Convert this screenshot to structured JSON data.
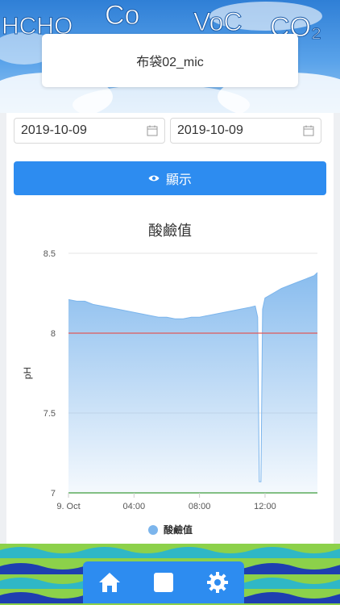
{
  "header": {
    "title": "布袋02_mic",
    "banner_words": [
      "HCHO",
      "Co",
      "VoC",
      "CO₂"
    ]
  },
  "filters": {
    "start_date": "2019-10-09",
    "end_date": "2019-10-09",
    "show_button_label": "顯示"
  },
  "chart_data": {
    "type": "area",
    "title": "酸鹼值",
    "ylabel": "pH",
    "ylim": [
      7,
      8.5
    ],
    "y_ticks": [
      "8.5",
      "8",
      "7.5",
      "7"
    ],
    "y_tick_values": [
      8.5,
      8,
      7.5,
      7
    ],
    "x_ticks": [
      "9. Oct",
      "04:00",
      "08:00",
      "12:00"
    ],
    "x_tick_hours": [
      0,
      4,
      8,
      12
    ],
    "x_range_hours": [
      0,
      15.2
    ],
    "reference_lines": [
      {
        "value": 8.0,
        "color": "#e05a5a"
      },
      {
        "value": 7.0,
        "color": "#3a9a3a"
      }
    ],
    "series": [
      {
        "name": "酸鹼值",
        "color": "#7cb5ec",
        "points": [
          [
            0.0,
            8.21
          ],
          [
            0.5,
            8.2
          ],
          [
            1.0,
            8.2
          ],
          [
            1.5,
            8.18
          ],
          [
            2.0,
            8.17
          ],
          [
            2.5,
            8.16
          ],
          [
            3.0,
            8.15
          ],
          [
            3.5,
            8.14
          ],
          [
            4.0,
            8.13
          ],
          [
            4.5,
            8.12
          ],
          [
            5.0,
            8.11
          ],
          [
            5.5,
            8.1
          ],
          [
            6.0,
            8.1
          ],
          [
            6.5,
            8.09
          ],
          [
            7.0,
            8.09
          ],
          [
            7.5,
            8.1
          ],
          [
            8.0,
            8.1
          ],
          [
            8.5,
            8.11
          ],
          [
            9.0,
            8.12
          ],
          [
            9.5,
            8.13
          ],
          [
            10.0,
            8.14
          ],
          [
            10.5,
            8.15
          ],
          [
            11.0,
            8.16
          ],
          [
            11.4,
            8.17
          ],
          [
            11.55,
            8.1
          ],
          [
            11.65,
            7.07
          ],
          [
            11.75,
            7.07
          ],
          [
            11.85,
            8.15
          ],
          [
            12.0,
            8.22
          ],
          [
            12.5,
            8.25
          ],
          [
            13.0,
            8.28
          ],
          [
            13.5,
            8.3
          ],
          [
            14.0,
            8.32
          ],
          [
            14.5,
            8.34
          ],
          [
            15.0,
            8.36
          ],
          [
            15.2,
            8.38
          ]
        ]
      }
    ],
    "legend": {
      "position": "bottom",
      "label": "酸鹼值"
    }
  },
  "nav": {
    "items": [
      {
        "name": "home",
        "icon": "home-icon"
      },
      {
        "name": "stop",
        "icon": "square-icon"
      },
      {
        "name": "settings",
        "icon": "gear-icon"
      }
    ]
  }
}
